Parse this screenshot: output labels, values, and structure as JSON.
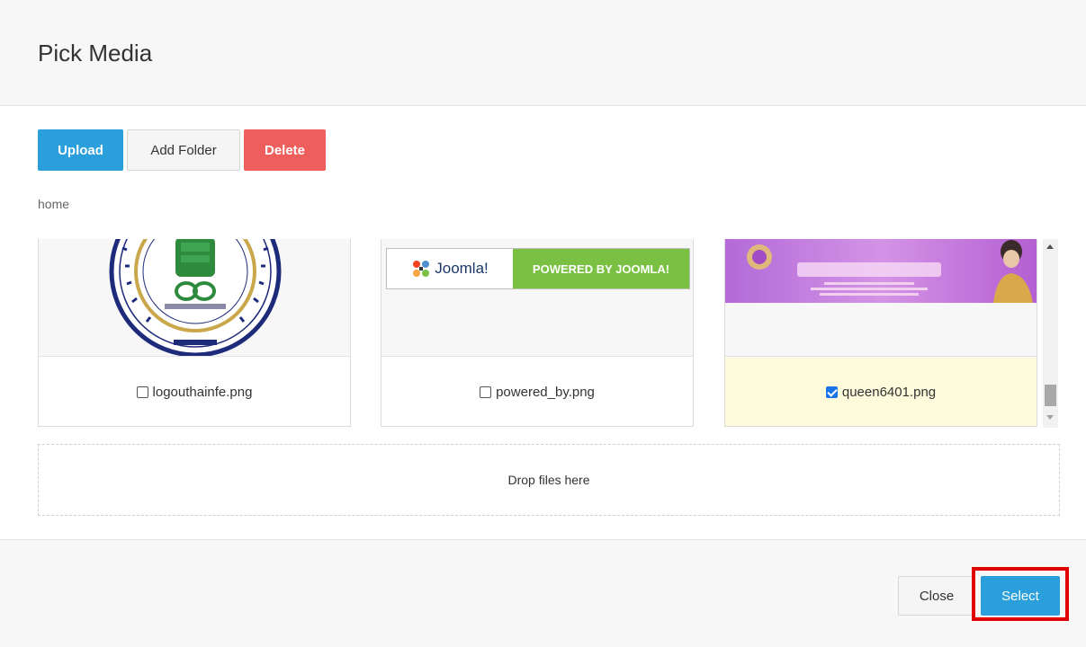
{
  "dialog": {
    "title": "Pick Media"
  },
  "toolbar": {
    "upload_label": "Upload",
    "add_folder_label": "Add Folder",
    "delete_label": "Delete"
  },
  "breadcrumb": {
    "path": "home"
  },
  "files": [
    {
      "name": "logouthainfe.png",
      "checked": false
    },
    {
      "name": "powered_by.png",
      "checked": false,
      "banner_brand": "Joomla!",
      "banner_text": "POWERED BY JOOMLA!"
    },
    {
      "name": "queen6401.png",
      "checked": true
    }
  ],
  "dropzone": {
    "label": "Drop files here"
  },
  "footer": {
    "close_label": "Close",
    "select_label": "Select"
  },
  "colors": {
    "primary": "#2a9fdc",
    "danger": "#ed5e5c",
    "selected_bg": "#fdfbdc",
    "highlight": "#e00000",
    "joomla_green": "#7ac143"
  }
}
